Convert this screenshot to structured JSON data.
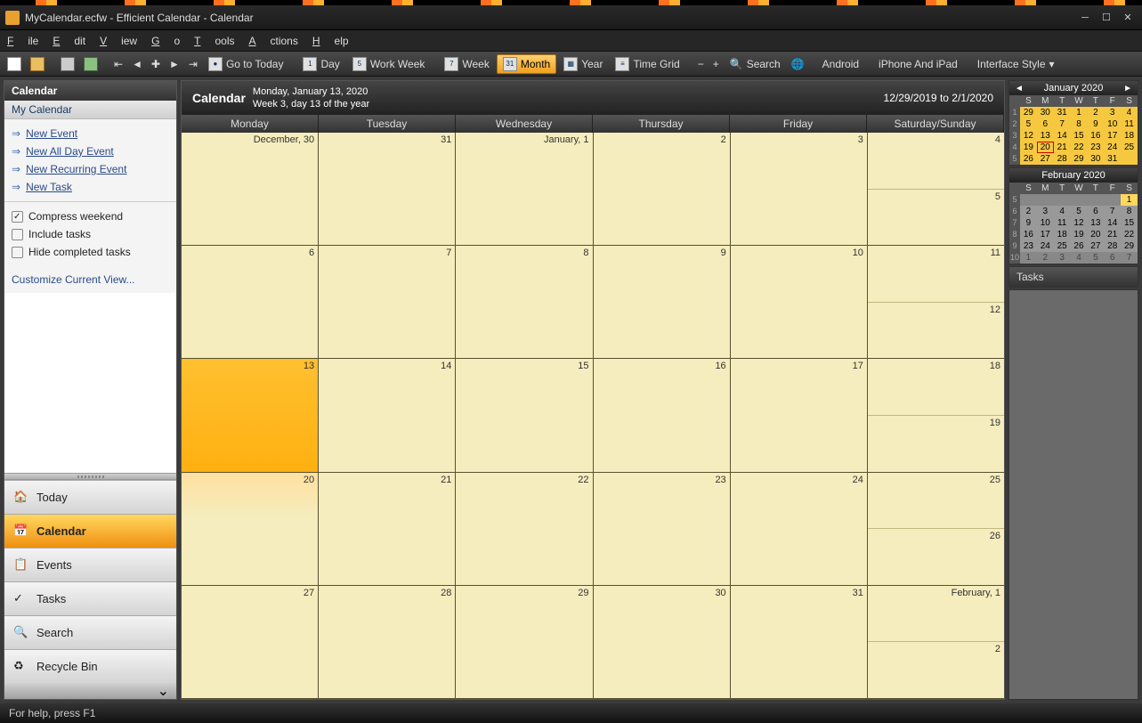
{
  "title": "MyCalendar.ecfw - Efficient Calendar - Calendar",
  "menu": [
    "File",
    "Edit",
    "View",
    "Go",
    "Tools",
    "Actions",
    "Help"
  ],
  "toolbar": {
    "goto": "Go to Today",
    "day": "Day",
    "workweek": "Work Week",
    "week": "Week",
    "month": "Month",
    "year": "Year",
    "timegrid": "Time Grid",
    "search": "Search",
    "android": "Android",
    "iphone": "iPhone And iPad",
    "style": "Interface Style"
  },
  "sidebar": {
    "header": "Calendar",
    "sub": "My Calendar",
    "links": [
      "New Event",
      "New All Day Event",
      "New Recurring Event",
      "New Task"
    ],
    "opts": {
      "compress": "Compress weekend",
      "include": "Include tasks",
      "hide": "Hide completed tasks"
    },
    "customize": "Customize Current View...",
    "nav": [
      "Today",
      "Calendar",
      "Events",
      "Tasks",
      "Search",
      "Recycle Bin"
    ]
  },
  "calendar": {
    "title": "Calendar",
    "date": "Monday, January 13, 2020",
    "sub": "Week 3, day 13 of the year",
    "range": "12/29/2019 to 2/1/2020",
    "days": [
      "Monday",
      "Tuesday",
      "Wednesday",
      "Thursday",
      "Friday",
      "Saturday/Sunday"
    ],
    "weeks": [
      [
        {
          "l": "December, 30"
        },
        {
          "l": "31"
        },
        {
          "l": "January, 1"
        },
        {
          "l": "2"
        },
        {
          "l": "3"
        },
        {
          "sat": "4",
          "sun": "5"
        }
      ],
      [
        {
          "l": "6"
        },
        {
          "l": "7"
        },
        {
          "l": "8"
        },
        {
          "l": "9"
        },
        {
          "l": "10"
        },
        {
          "sat": "11",
          "sun": "12"
        }
      ],
      [
        {
          "l": "13",
          "today": true
        },
        {
          "l": "14"
        },
        {
          "l": "15"
        },
        {
          "l": "16"
        },
        {
          "l": "17"
        },
        {
          "sat": "18",
          "sun": "19"
        }
      ],
      [
        {
          "l": "20",
          "upcoming": true
        },
        {
          "l": "21"
        },
        {
          "l": "22"
        },
        {
          "l": "23"
        },
        {
          "l": "24"
        },
        {
          "sat": "25",
          "sun": "26"
        }
      ],
      [
        {
          "l": "27"
        },
        {
          "l": "28"
        },
        {
          "l": "29"
        },
        {
          "l": "30"
        },
        {
          "l": "31"
        },
        {
          "sat": "February, 1",
          "sun": "2"
        }
      ]
    ]
  },
  "mini1": {
    "title": "January 2020",
    "wh": [
      "S",
      "M",
      "T",
      "W",
      "T",
      "F",
      "S"
    ],
    "rows": [
      {
        "wn": "1",
        "d": [
          {
            "n": "29",
            "o": 1
          },
          {
            "n": "30",
            "o": 1
          },
          {
            "n": "31",
            "o": 1
          },
          {
            "n": "1"
          },
          {
            "n": "2"
          },
          {
            "n": "3"
          },
          {
            "n": "4"
          }
        ]
      },
      {
        "wn": "2",
        "d": [
          {
            "n": "5"
          },
          {
            "n": "6"
          },
          {
            "n": "7"
          },
          {
            "n": "8"
          },
          {
            "n": "9"
          },
          {
            "n": "10"
          },
          {
            "n": "11"
          }
        ]
      },
      {
        "wn": "3",
        "d": [
          {
            "n": "12"
          },
          {
            "n": "13"
          },
          {
            "n": "14"
          },
          {
            "n": "15"
          },
          {
            "n": "16"
          },
          {
            "n": "17"
          },
          {
            "n": "18"
          }
        ]
      },
      {
        "wn": "4",
        "d": [
          {
            "n": "19"
          },
          {
            "n": "20",
            "t": 1
          },
          {
            "n": "21"
          },
          {
            "n": "22"
          },
          {
            "n": "23"
          },
          {
            "n": "24"
          },
          {
            "n": "25"
          }
        ]
      },
      {
        "wn": "5",
        "d": [
          {
            "n": "26"
          },
          {
            "n": "27"
          },
          {
            "n": "28"
          },
          {
            "n": "29"
          },
          {
            "n": "30"
          },
          {
            "n": "31"
          },
          {
            "n": "",
            "o": 1
          }
        ]
      }
    ]
  },
  "mini2": {
    "title": "February 2020",
    "wh": [
      "S",
      "M",
      "T",
      "W",
      "T",
      "F",
      "S"
    ],
    "rows": [
      {
        "wn": "5",
        "d": [
          {
            "n": "",
            "o": 1
          },
          {
            "n": "",
            "o": 1
          },
          {
            "n": "",
            "o": 1
          },
          {
            "n": "",
            "o": 1
          },
          {
            "n": "",
            "o": 1
          },
          {
            "n": "",
            "o": 1
          },
          {
            "n": "1",
            "s": 1
          }
        ]
      },
      {
        "wn": "6",
        "d": [
          {
            "n": "2"
          },
          {
            "n": "3"
          },
          {
            "n": "4"
          },
          {
            "n": "5"
          },
          {
            "n": "6"
          },
          {
            "n": "7"
          },
          {
            "n": "8"
          }
        ]
      },
      {
        "wn": "7",
        "d": [
          {
            "n": "9"
          },
          {
            "n": "10"
          },
          {
            "n": "11"
          },
          {
            "n": "12"
          },
          {
            "n": "13"
          },
          {
            "n": "14"
          },
          {
            "n": "15"
          }
        ]
      },
      {
        "wn": "8",
        "d": [
          {
            "n": "16"
          },
          {
            "n": "17"
          },
          {
            "n": "18"
          },
          {
            "n": "19"
          },
          {
            "n": "20"
          },
          {
            "n": "21"
          },
          {
            "n": "22"
          }
        ]
      },
      {
        "wn": "9",
        "d": [
          {
            "n": "23"
          },
          {
            "n": "24"
          },
          {
            "n": "25"
          },
          {
            "n": "26"
          },
          {
            "n": "27"
          },
          {
            "n": "28"
          },
          {
            "n": "29"
          }
        ]
      },
      {
        "wn": "10",
        "d": [
          {
            "n": "1",
            "o": 1
          },
          {
            "n": "2",
            "o": 1
          },
          {
            "n": "3",
            "o": 1
          },
          {
            "n": "4",
            "o": 1
          },
          {
            "n": "5",
            "o": 1
          },
          {
            "n": "6",
            "o": 1
          },
          {
            "n": "7",
            "o": 1
          }
        ]
      }
    ]
  },
  "tasks": "Tasks",
  "status": "For help, press F1"
}
